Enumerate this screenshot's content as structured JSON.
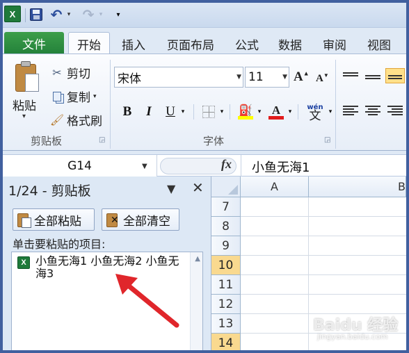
{
  "qat": {
    "logo_letter": "X",
    "icons": [
      "save-icon",
      "undo-icon",
      "redo-icon",
      "customize-dropdown-icon"
    ]
  },
  "tabs": {
    "file": "文件",
    "items": [
      "开始",
      "插入",
      "页面布局",
      "公式",
      "数据",
      "审阅",
      "视图"
    ],
    "active": "开始"
  },
  "ribbon": {
    "clipboard": {
      "paste": "粘贴",
      "cut": "剪切",
      "copy": "复制",
      "format_painter": "格式刷",
      "label": "剪贴板"
    },
    "font": {
      "font_name": "宋体",
      "font_size": "11",
      "grow": "A",
      "shrink": "A",
      "bold": "B",
      "italic": "I",
      "underline": "U",
      "font_color_glyph": "A",
      "phonetic_pinyin": "wén",
      "phonetic_char": "文",
      "label": "字体",
      "fill_color": "#ffff00",
      "font_color": "#e11b1b"
    }
  },
  "formula_bar": {
    "name_box": "G14",
    "fx": "fx",
    "content": "小鱼无海1"
  },
  "clipboard_pane": {
    "title": "1/24 - 剪贴板",
    "paste_all": "全部粘贴",
    "clear_all": "全部清空",
    "hint": "单击要粘贴的项目:",
    "item_text": "小鱼无海1 小鱼无海2 小鱼无海3"
  },
  "sheet": {
    "columns": [
      "A",
      "B"
    ],
    "rows": [
      "7",
      "8",
      "9",
      "10",
      "11",
      "12",
      "13",
      "14"
    ],
    "highlighted_rows": [
      "10",
      "14"
    ]
  },
  "watermark": {
    "brand": "Baidu 经验",
    "url": "jingyan.baidu.com"
  },
  "colors": {
    "file_tab": "#23813a",
    "row_highlight": "#f9d98f",
    "annotation_arrow": "#e0262b"
  }
}
